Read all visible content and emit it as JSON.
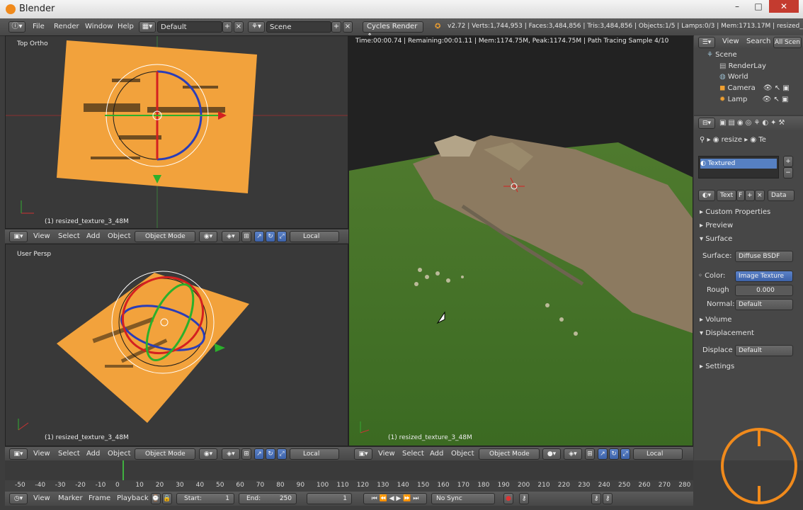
{
  "window": {
    "title": "Blender",
    "min": "–",
    "max": "□",
    "close": "✕"
  },
  "info_header": {
    "menus": [
      "File",
      "Render",
      "Window",
      "Help"
    ],
    "screen_layout": "Default",
    "scene": "Scene",
    "render_engine": "Cycles Render",
    "stats": "v2.72 | Verts:1,744,953 | Faces:3,484,856 | Tris:3,484,856 | Objects:1/5 | Lamps:0/3 | Mem:1713.17M | resized_texture_3_4"
  },
  "viewport_top": {
    "label": "Top Ortho",
    "object_label": "(1) resized_texture_3_48M",
    "menus": [
      "View",
      "Select",
      "Add",
      "Object"
    ],
    "mode": "Object Mode",
    "orientation": "Local"
  },
  "viewport_persp": {
    "label": "User Persp",
    "object_label": "(1) resized_texture_3_48M",
    "menus": [
      "View",
      "Select",
      "Add",
      "Object"
    ],
    "mode": "Object Mode",
    "orientation": "Local"
  },
  "viewport_render": {
    "status": "Time:00:00.74 | Remaining:00:01.11 | Mem:1174.75M, Peak:1174.75M | Path Tracing Sample 4/10",
    "object_label": "(1) resized_texture_3_48M",
    "menus": [
      "View",
      "Select",
      "Add",
      "Object"
    ],
    "mode": "Object Mode",
    "orientation": "Local"
  },
  "outliner": {
    "menus": [
      "View",
      "Search",
      "All Scen"
    ],
    "tree": [
      {
        "label": "Scene",
        "depth": 0
      },
      {
        "label": "RenderLay",
        "depth": 1
      },
      {
        "label": "World",
        "depth": 1
      },
      {
        "label": "Camera",
        "depth": 1
      },
      {
        "label": "Lamp",
        "depth": 1
      }
    ]
  },
  "properties": {
    "breadcrumb": [
      "resize",
      "Te"
    ],
    "material_slot": "Textured",
    "material_name": "Text",
    "material_f": "F",
    "data_dropdown": "Data",
    "sections": {
      "custom_props": "Custom Properties",
      "preview": "Preview",
      "surface": "Surface",
      "volume": "Volume",
      "displacement": "Displacement",
      "settings": "Settings"
    },
    "surface_label": "Surface:",
    "surface_value": "Diffuse BSDF",
    "color_label": "Color:",
    "color_value": "Image Texture",
    "rough_label": "Rough",
    "rough_value": "0.000",
    "normal_label": "Normal:",
    "normal_value": "Default",
    "displace_label": "Displace",
    "displace_value": "Default"
  },
  "timeline": {
    "ticks": [
      "-50",
      "-40",
      "-30",
      "-20",
      "-10",
      "0",
      "10",
      "20",
      "30",
      "40",
      "50",
      "60",
      "70",
      "80",
      "90",
      "100",
      "110",
      "120",
      "130",
      "140",
      "150",
      "160",
      "170",
      "180",
      "190",
      "200",
      "210",
      "220",
      "230",
      "240",
      "250",
      "260",
      "270",
      "280"
    ],
    "menus": [
      "View",
      "Marker",
      "Frame",
      "Playback"
    ],
    "start_label": "Start:",
    "start_value": "1",
    "end_label": "End:",
    "end_value": "250",
    "current_frame": "1",
    "sync": "No Sync"
  }
}
